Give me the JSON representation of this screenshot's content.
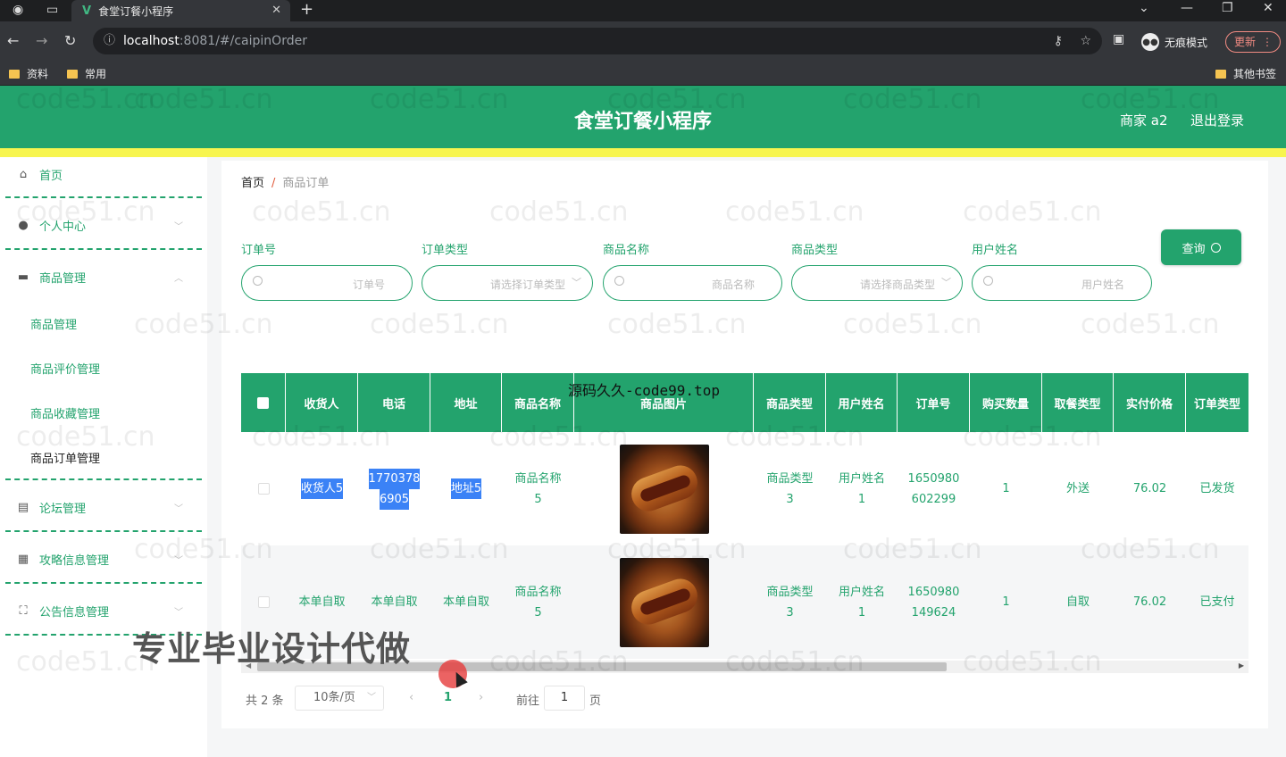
{
  "browser": {
    "tab_title": "食堂订餐小程序",
    "tab_logo": "V",
    "url_host": "localhost",
    "url_path": ":8081/#/caipinOrder",
    "incognito_label": "无痕模式",
    "update_label": "更新",
    "bookmarks": [
      "资料",
      "常用"
    ],
    "other_bookmarks": "其他书签"
  },
  "header": {
    "title": "食堂订餐小程序",
    "user": "商家 a2",
    "logout": "退出登录"
  },
  "sidebar": {
    "home": "首页",
    "personal": "个人中心",
    "goods": "商品管理",
    "goods_sub": [
      "商品管理",
      "商品评价管理",
      "商品收藏管理",
      "商品订单管理"
    ],
    "forum": "论坛管理",
    "guide": "攻略信息管理",
    "notice": "公告信息管理"
  },
  "breadcrumb": {
    "home": "首页",
    "sep": "/",
    "current": "商品订单"
  },
  "filters": {
    "order_no": {
      "label": "订单号",
      "placeholder": "订单号"
    },
    "order_type": {
      "label": "订单类型",
      "placeholder": "请选择订单类型"
    },
    "goods_name": {
      "label": "商品名称",
      "placeholder": "商品名称"
    },
    "goods_type": {
      "label": "商品类型",
      "placeholder": "请选择商品类型"
    },
    "user_name": {
      "label": "用户姓名",
      "placeholder": "用户姓名"
    },
    "query_btn": "查询"
  },
  "table": {
    "headers": [
      "收货人",
      "电话",
      "地址",
      "商品名称",
      "商品图片",
      "商品类型",
      "用户姓名",
      "订单号",
      "购买数量",
      "取餐类型",
      "实付价格",
      "订单类型"
    ],
    "rows": [
      {
        "receiver": "收货人5",
        "phone_a": "1770378",
        "phone_b": "6905",
        "address": "地址5",
        "goods_name_a": "商品名称",
        "goods_name_b": "5",
        "goods_type_a": "商品类型",
        "goods_type_b": "3",
        "user_a": "用户姓名",
        "user_b": "1",
        "order_a": "1650980",
        "order_b": "602299",
        "qty": "1",
        "pickup": "外送",
        "price": "76.02",
        "status": "已发货"
      },
      {
        "receiver": "本单自取",
        "phone_a": "本单自取",
        "phone_b": "",
        "address": "本单自取",
        "goods_name_a": "商品名称",
        "goods_name_b": "5",
        "goods_type_a": "商品类型",
        "goods_type_b": "3",
        "user_a": "用户姓名",
        "user_b": "1",
        "order_a": "1650980",
        "order_b": "149624",
        "qty": "1",
        "pickup": "自取",
        "price": "76.02",
        "status": "已支付"
      }
    ]
  },
  "pagination": {
    "total": "共 2 条",
    "page_size": "10条/页",
    "current": "1",
    "goto_label": "前往",
    "goto_value": "1",
    "page_unit": "页"
  },
  "overlays": {
    "watermark": "code51.cn",
    "source_text": "源码久久-code99.top",
    "promo_text": "专业毕业设计代做"
  },
  "colors": {
    "primary": "#23a36d",
    "accent_strip": "#f7f54f"
  }
}
